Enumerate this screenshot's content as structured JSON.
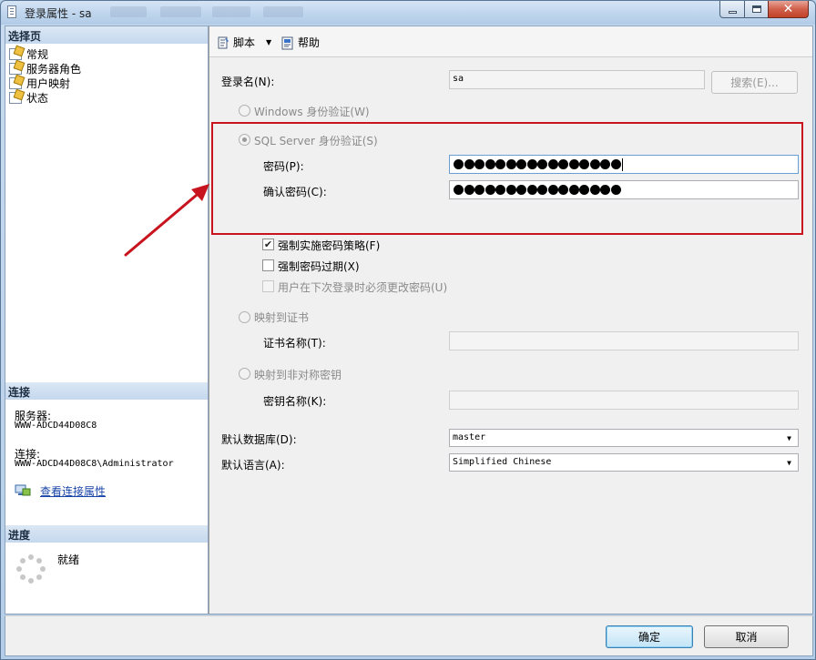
{
  "window": {
    "title": "登录属性 - sa"
  },
  "left": {
    "select_page_header": "选择页",
    "pages": [
      {
        "label": "常规"
      },
      {
        "label": "服务器角色"
      },
      {
        "label": "用户映射"
      },
      {
        "label": "状态"
      }
    ],
    "connection_header": "连接",
    "server_label": "服务器:",
    "server_value": "WWW-ADCD44D08C8",
    "connection_label": "连接:",
    "connection_value": "WWW-ADCD44D08C8\\Administrator",
    "view_connection_link": "查看连接属性",
    "progress_header": "进度",
    "progress_status": "就绪"
  },
  "toolbar": {
    "script_label": "脚本",
    "help_label": "帮助"
  },
  "form": {
    "login_name_label": "登录名(N):",
    "login_name_value": "sa",
    "search_button": "搜索(E)...",
    "windows_auth_label": "Windows 身份验证(W)",
    "sql_auth_label": "SQL Server 身份验证(S)",
    "password_label": "密码(P):",
    "password_dot_count": 16,
    "confirm_password_label": "确认密码(C):",
    "confirm_dot_count": 16,
    "enforce_policy_label": "强制实施密码策略(F)",
    "enforce_policy_checked": true,
    "enforce_expiration_label": "强制密码过期(X)",
    "enforce_expiration_checked": false,
    "must_change_label": "用户在下次登录时必须更改密码(U)",
    "must_change_checked": false,
    "map_cert_label": "映射到证书",
    "cert_name_label": "证书名称(T):",
    "map_asym_key_label": "映射到非对称密钥",
    "key_name_label": "密钥名称(K):",
    "default_db_label": "默认数据库(D):",
    "default_db_value": "master",
    "default_lang_label": "默认语言(A):",
    "default_lang_value": "Simplified Chinese"
  },
  "footer": {
    "ok_button": "确定",
    "cancel_button": "取消"
  },
  "colors": {
    "highlight": "#c8141e",
    "link": "#1a45a8"
  }
}
